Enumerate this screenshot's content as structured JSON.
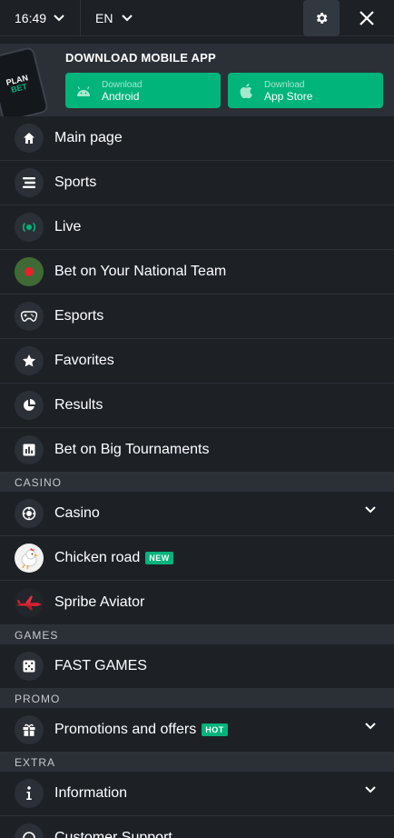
{
  "topbar": {
    "time": "16:49",
    "language": "EN"
  },
  "app_banner": {
    "title": "DOWNLOAD MOBILE APP",
    "phone_logo_top": "PLAN",
    "phone_logo_bottom": "BET",
    "android": {
      "sub": "Download",
      "main": "Android"
    },
    "ios": {
      "sub": "Download",
      "main": "App Store"
    }
  },
  "menu": {
    "main": [
      {
        "label": "Main page",
        "icon": "home-icon"
      },
      {
        "label": "Sports",
        "icon": "sports-icon"
      },
      {
        "label": "Live",
        "icon": "live-icon"
      },
      {
        "label": "Bet on Your National Team",
        "icon": "national-team-icon"
      },
      {
        "label": "Esports",
        "icon": "gamepad-icon"
      },
      {
        "label": "Favorites",
        "icon": "star-icon"
      },
      {
        "label": "Results",
        "icon": "pie-chart-icon"
      },
      {
        "label": "Bet on Big Tournaments",
        "icon": "bar-chart-icon"
      }
    ],
    "sections": {
      "casino": "CASINO",
      "games": "GAMES",
      "promo": "PROMO",
      "extra": "EXTRA"
    },
    "casino": [
      {
        "label": "Casino",
        "icon": "casino-chip-icon"
      },
      {
        "label": "Chicken road",
        "icon": "chicken-icon",
        "badge": "NEW"
      },
      {
        "label": "Spribe Aviator",
        "icon": "aviator-plane-icon"
      }
    ],
    "games": [
      {
        "label": "FAST GAMES",
        "icon": "dice-icon"
      }
    ],
    "promo": [
      {
        "label": "Promotions and offers",
        "icon": "gift-icon",
        "badge": "HOT"
      }
    ],
    "extra": [
      {
        "label": "Information",
        "icon": "info-icon"
      },
      {
        "label": "Customer Support",
        "icon": "support-icon"
      }
    ]
  },
  "colors": {
    "accent": "#00b47a",
    "background": "#1d2126",
    "panel": "#2b3037"
  }
}
